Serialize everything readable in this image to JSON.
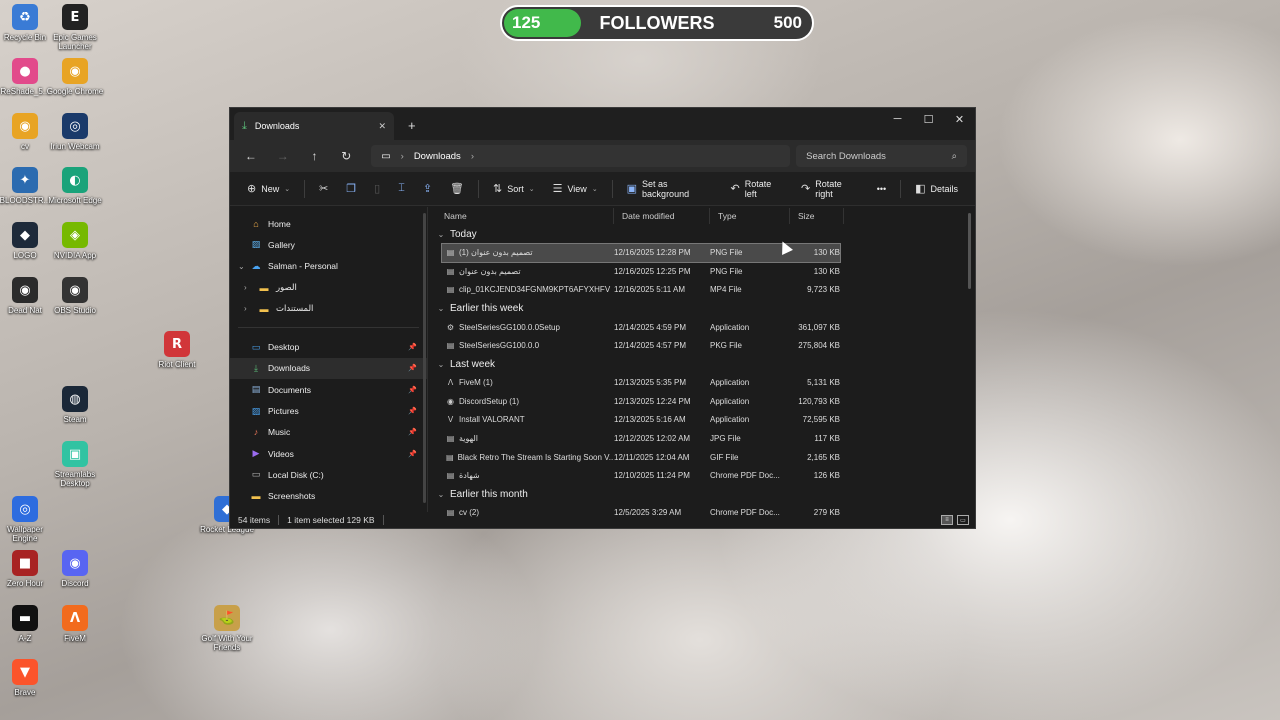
{
  "followers": {
    "current": "125",
    "title": "FOLLOWERS",
    "goal": "500",
    "progress": 0.25,
    "fill_color": "#41b94b"
  },
  "desktop_icons": [
    {
      "label": "Recycle Bin",
      "glyph": "♻",
      "color": "#3a7bd5"
    },
    {
      "label": "Epic Games Launcher",
      "glyph": "E",
      "color": "#222222"
    },
    {
      "label": "ReShade_5...",
      "glyph": "●",
      "color": "#e24a8b"
    },
    {
      "label": "Google Chrome",
      "glyph": "◉",
      "color": "#e8a424"
    },
    {
      "label": "cv",
      "glyph": "◉",
      "color": "#e8a424"
    },
    {
      "label": "Iriun Webcam",
      "glyph": "◎",
      "color": "#1a3a6a"
    },
    {
      "label": "BLOODSTR...",
      "glyph": "✦",
      "color": "#2b6bb0"
    },
    {
      "label": "Microsoft Edge",
      "glyph": "◐",
      "color": "#1aa37a"
    },
    {
      "label": "LOGO",
      "glyph": "◆",
      "color": "#1e2a3a"
    },
    {
      "label": "NVIDIA App",
      "glyph": "◈",
      "color": "#76b900"
    },
    {
      "label": "Dead Nat",
      "glyph": "◉",
      "color": "#2b2b2b"
    },
    {
      "label": "OBS Studio",
      "glyph": "◉",
      "color": "#333333"
    },
    {
      "label": "Riot Client",
      "glyph": "R",
      "color": "#d13639"
    },
    {
      "label": "Steam",
      "glyph": "◍",
      "color": "#1b2838"
    },
    {
      "label": "Streamlabs Desktop",
      "glyph": "▣",
      "color": "#31c3a2"
    },
    {
      "label": "Wallpaper Engine",
      "glyph": "◎",
      "color": "#2d6cdf"
    },
    {
      "label": "Zero Hour",
      "glyph": "■",
      "color": "#a82323"
    },
    {
      "label": "Discord",
      "glyph": "◉",
      "color": "#5865f2"
    },
    {
      "label": "A-Z",
      "glyph": "▬",
      "color": "#111111"
    },
    {
      "label": "FiveM",
      "glyph": "Λ",
      "color": "#f26b1d"
    },
    {
      "label": "Golf With Your Friends",
      "glyph": "⛳",
      "color": "#c8a04a"
    },
    {
      "label": "Brave",
      "glyph": "▼",
      "color": "#fb542b"
    },
    {
      "label": "Rocket League",
      "glyph": "◆",
      "color": "#2f6fd6"
    }
  ],
  "window": {
    "tab_title": "Downloads",
    "new_tab": "+",
    "controls": [
      "─",
      "☐",
      "✕"
    ],
    "breadcrumb": [
      "Downloads"
    ],
    "search_placeholder": "Search Downloads",
    "toolbar": {
      "new": "New",
      "sort": "Sort",
      "view": "View",
      "set_background": "Set as background",
      "rotate_left": "Rotate left",
      "rotate_right": "Rotate right",
      "more": "•••",
      "details": "Details"
    },
    "nav": {
      "home": "Home",
      "gallery": "Gallery",
      "onedrive": "Salman - Personal",
      "folder1": "الصور",
      "folder2": "المستندات",
      "desktop": "Desktop",
      "downloads": "Downloads",
      "documents": "Documents",
      "pictures": "Pictures",
      "music": "Music",
      "videos": "Videos",
      "local_disk": "Local Disk (C:)",
      "screenshots": "Screenshots"
    },
    "columns": {
      "name": "Name",
      "date": "Date modified",
      "type": "Type",
      "size": "Size"
    },
    "groups": [
      {
        "label": "Today",
        "files": [
          {
            "name": "تصميم بدون عنوان (1)",
            "date": "12/16/2025 12:28 PM",
            "type": "PNG File",
            "size": "130 KB",
            "icon": "▤"
          },
          {
            "name": "تصميم بدون عنوان",
            "date": "12/16/2025 12:25 PM",
            "type": "PNG File",
            "size": "130 KB",
            "icon": "▤"
          },
          {
            "name": "clip_01KCJEND34FGNM9KPT6AFYXHFV",
            "date": "12/16/2025 5:11 AM",
            "type": "MP4 File",
            "size": "9,723 KB",
            "icon": "▤"
          }
        ]
      },
      {
        "label": "Earlier this week",
        "files": [
          {
            "name": "SteelSeriesGG100.0.0Setup",
            "date": "12/14/2025 4:59 PM",
            "type": "Application",
            "size": "361,097 KB",
            "icon": "⚙"
          },
          {
            "name": "SteelSeriesGG100.0.0",
            "date": "12/14/2025 4:57 PM",
            "type": "PKG File",
            "size": "275,804 KB",
            "icon": "▤"
          }
        ]
      },
      {
        "label": "Last week",
        "files": [
          {
            "name": "FiveM (1)",
            "date": "12/13/2025 5:35 PM",
            "type": "Application",
            "size": "5,131 KB",
            "icon": "Λ"
          },
          {
            "name": "DiscordSetup (1)",
            "date": "12/13/2025 12:24 PM",
            "type": "Application",
            "size": "120,793 KB",
            "icon": "◉"
          },
          {
            "name": "Install VALORANT",
            "date": "12/13/2025 5:16 AM",
            "type": "Application",
            "size": "72,595 KB",
            "icon": "V"
          },
          {
            "name": "الهوية",
            "date": "12/12/2025 12:02 AM",
            "type": "JPG File",
            "size": "117 KB",
            "icon": "▤"
          },
          {
            "name": "Black Retro The Stream Is Starting Soon V...",
            "date": "12/11/2025 12:04 AM",
            "type": "GIF File",
            "size": "2,165 KB",
            "icon": "▤"
          },
          {
            "name": "شهادة",
            "date": "12/10/2025 11:24 PM",
            "type": "Chrome PDF Doc...",
            "size": "126 KB",
            "icon": "▤"
          }
        ]
      },
      {
        "label": "Earlier this month",
        "files": [
          {
            "name": "cv (2)",
            "date": "12/5/2025 3:29 AM",
            "type": "Chrome PDF Doc...",
            "size": "279 KB",
            "icon": "▤"
          }
        ]
      }
    ],
    "status": {
      "items": "54 items",
      "selected": "1 item selected  129 KB"
    }
  }
}
